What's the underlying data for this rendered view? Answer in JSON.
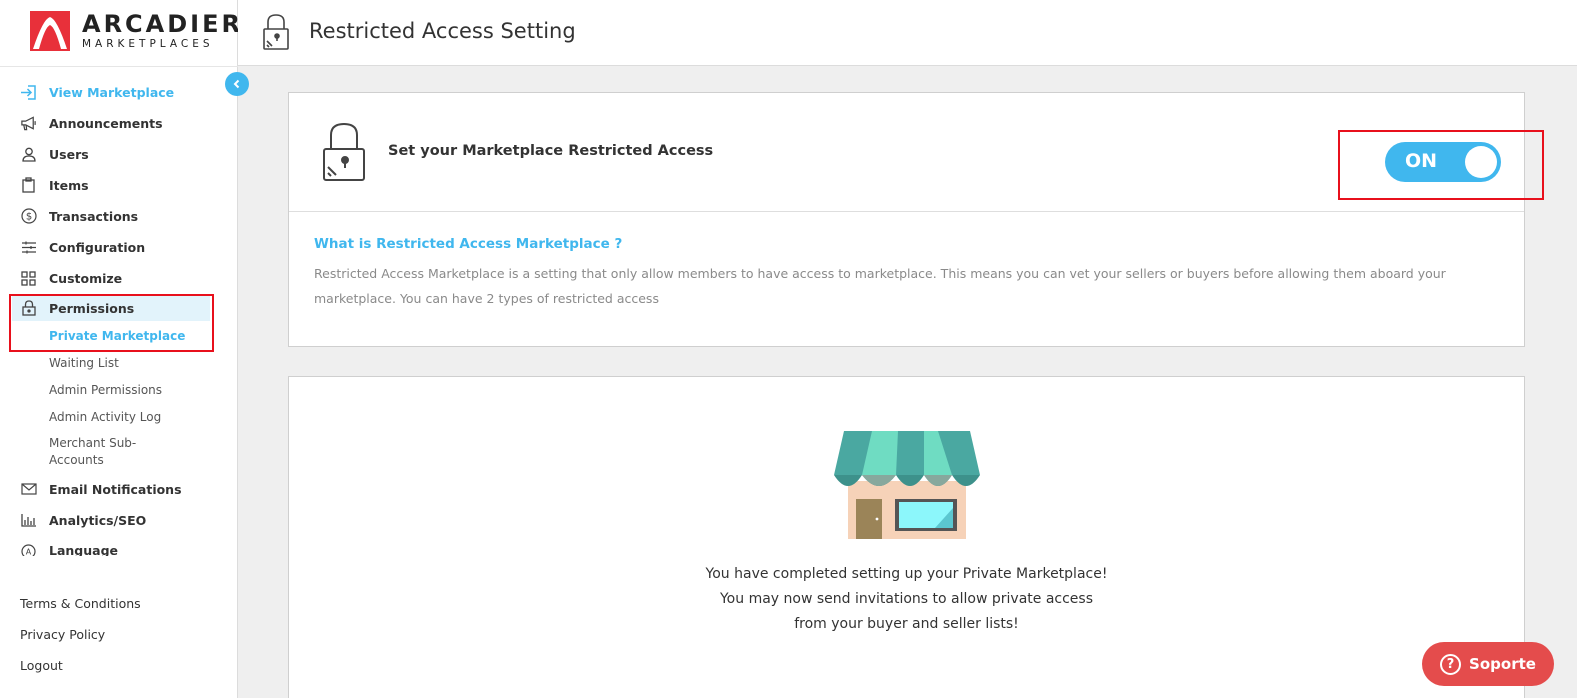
{
  "brand": {
    "name": "ARCADIER",
    "tagline": "MARKETPLACES",
    "accent_color": "#40b7ee",
    "logo_color": "#e8303a"
  },
  "header": {
    "title": "Restricted Access Setting"
  },
  "sidebar": {
    "items": [
      {
        "label": "View Marketplace",
        "icon": "enter-icon"
      },
      {
        "label": "Announcements",
        "icon": "megaphone-icon"
      },
      {
        "label": "Users",
        "icon": "user-icon"
      },
      {
        "label": "Items",
        "icon": "clipboard-icon"
      },
      {
        "label": "Transactions",
        "icon": "dollar-icon"
      },
      {
        "label": "Configuration",
        "icon": "sliders-icon"
      },
      {
        "label": "Customize",
        "icon": "grid-icon"
      },
      {
        "label": "Permissions",
        "icon": "lock-icon"
      },
      {
        "label": "Email Notifications",
        "icon": "envelope-icon"
      },
      {
        "label": "Analytics/SEO",
        "icon": "bar-chart-icon"
      },
      {
        "label": "Language",
        "icon": "translate-icon"
      }
    ],
    "permissions_sub": [
      {
        "label": "Private Marketplace"
      },
      {
        "label": "Waiting List"
      },
      {
        "label": "Admin Permissions"
      },
      {
        "label": "Admin Activity Log"
      },
      {
        "label": "Merchant Sub-",
        "label2": "Accounts"
      }
    ],
    "footer": [
      "Terms & Conditions",
      "Privacy Policy",
      "Logout"
    ]
  },
  "restricted_card": {
    "set_label": "Set your Marketplace Restricted Access",
    "toggle_state": "ON",
    "what_title": "What is Restricted Access Marketplace ?",
    "what_desc": "Restricted Access Marketplace is a setting that only allow members to have access to marketplace. This means you can vet your sellers or buyers before allowing them aboard your marketplace. You can have 2 types of restricted access"
  },
  "complete_card": {
    "line1": "You have completed setting up your Private Marketplace!",
    "line2": "You may now send invitations to allow private access",
    "line3": "from your buyer and seller lists!"
  },
  "support": {
    "label": "Soporte",
    "color": "#e44c4c"
  }
}
